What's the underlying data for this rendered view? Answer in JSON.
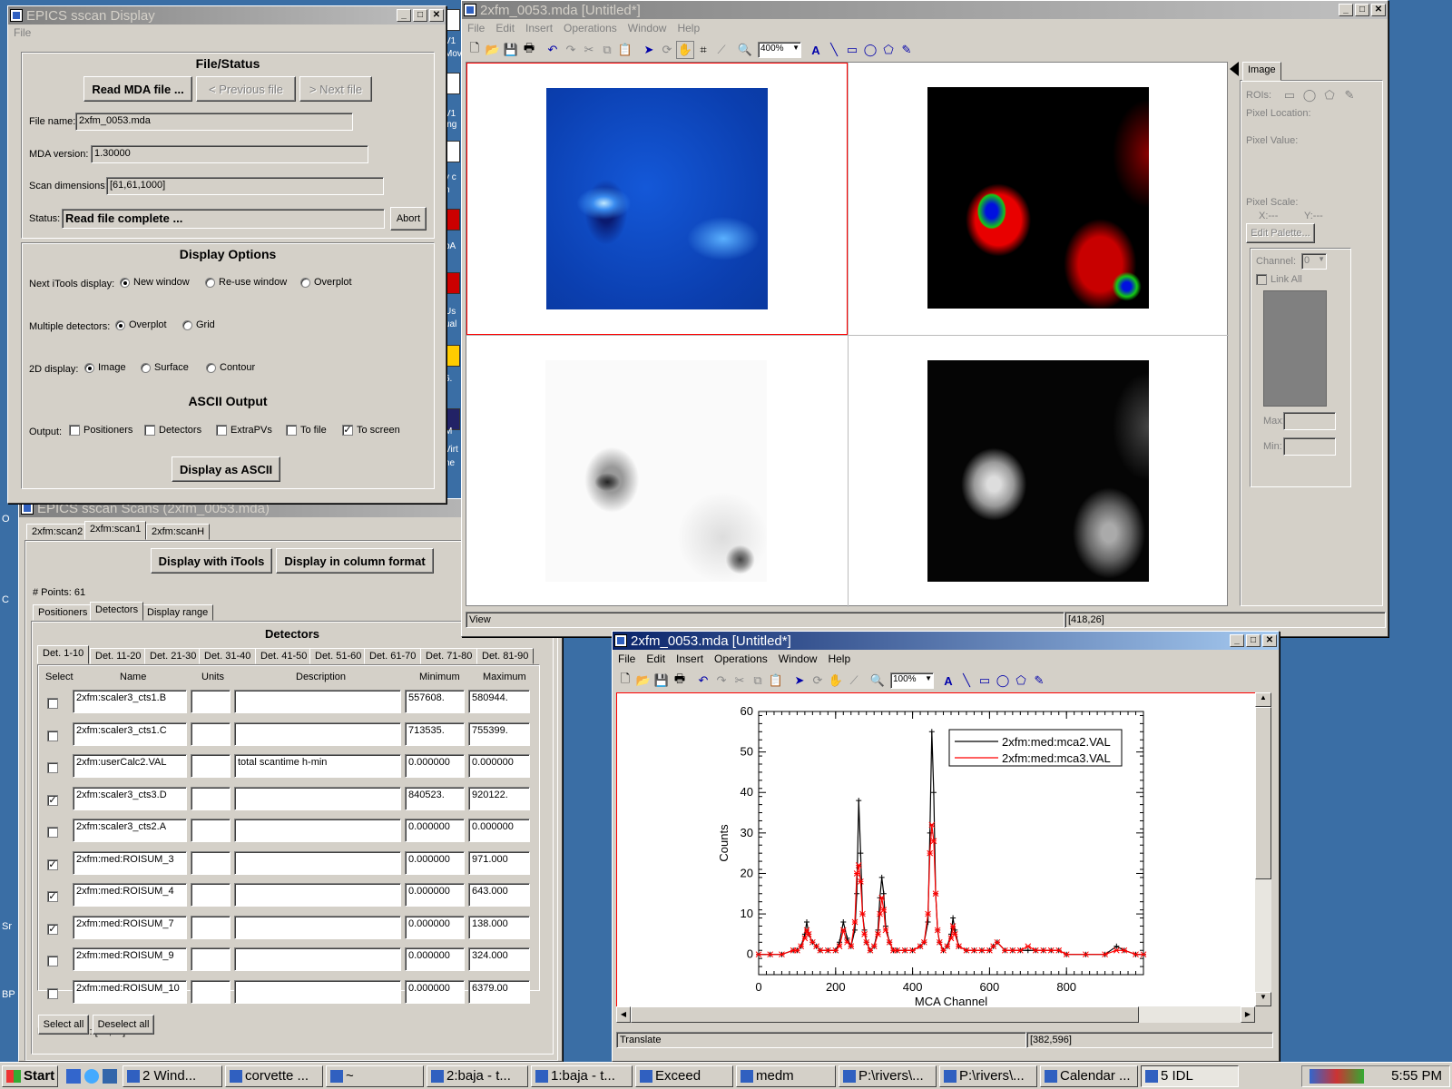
{
  "desktop": {
    "left_labels": [
      "O",
      "C",
      "Sr",
      "BP"
    ],
    "right_strip": [
      "V1",
      "Mov",
      "V1",
      "ing",
      "y c",
      "n",
      "pA",
      "Us",
      "ual",
      "6.",
      "M",
      "Virt",
      "ne"
    ]
  },
  "sscan": {
    "title": "EPICS sscan Display",
    "menu": [
      "File"
    ],
    "file_status": {
      "heading": "File/Status",
      "read_btn": "Read MDA file ...",
      "prev_btn": "< Previous file",
      "next_btn": "> Next file",
      "file_name_label": "File name:",
      "file_name": "2xfm_0053.mda",
      "mda_version_label": "MDA version:",
      "mda_version": "1.30000",
      "scan_dims_label": "Scan dimensions:",
      "scan_dims": "[61,61,1000]",
      "status_label": "Status:",
      "status": "Read file complete ...",
      "abort_btn": "Abort"
    },
    "display_options": {
      "heading": "Display Options",
      "next_label": "Next iTools display:",
      "next_opts": [
        "New window",
        "Re-use window",
        "Overplot"
      ],
      "multi_label": "Multiple detectors:",
      "multi_opts": [
        "Overplot",
        "Grid"
      ],
      "twod_label": "2D display:",
      "twod_opts": [
        "Image",
        "Surface",
        "Contour"
      ]
    },
    "ascii": {
      "heading": "ASCII Output",
      "output_label": "Output:",
      "opts": [
        "Positioners",
        "Detectors",
        "ExtraPVs",
        "To file",
        "To screen"
      ],
      "display_btn": "Display as ASCII"
    }
  },
  "scans": {
    "title": "EPICS sscan Scans (2xfm_0053.mda)",
    "tabs": [
      "2xfm:scan2",
      "2xfm:scan1",
      "2xfm:scanH"
    ],
    "itools_btn": "Display with iTools",
    "column_btn": "Display in column format",
    "points": "# Points: 61",
    "subtabs": [
      "Positioners",
      "Detectors",
      "Display range"
    ],
    "detectors_heading": "Detectors",
    "det_tabs": [
      "Det. 1-10",
      "Det. 11-20",
      "Det. 21-30",
      "Det. 31-40",
      "Det. 41-50",
      "Det. 51-60",
      "Det. 61-70",
      "Det. 71-80",
      "Det. 81-90"
    ],
    "columns": [
      "Select",
      "Name",
      "Units",
      "Description",
      "Minimum",
      "Maximum"
    ],
    "rows": [
      {
        "checked": false,
        "name": "2xfm:scaler3_cts1.B",
        "units": "",
        "desc": "",
        "min": "557608.",
        "max": "580944."
      },
      {
        "checked": false,
        "name": "2xfm:scaler3_cts1.C",
        "units": "",
        "desc": "",
        "min": "713535.",
        "max": "755399."
      },
      {
        "checked": false,
        "name": "2xfm:userCalc2.VAL",
        "units": "",
        "desc": "total scantime h-min",
        "min": "0.000000",
        "max": "0.000000"
      },
      {
        "checked": true,
        "name": "2xfm:scaler3_cts3.D",
        "units": "",
        "desc": "",
        "min": "840523.",
        "max": "920122."
      },
      {
        "checked": false,
        "name": "2xfm:scaler3_cts2.A",
        "units": "",
        "desc": "",
        "min": "0.000000",
        "max": "0.000000"
      },
      {
        "checked": true,
        "name": "2xfm:med:ROISUM_3",
        "units": "",
        "desc": "",
        "min": "0.000000",
        "max": "971.000"
      },
      {
        "checked": true,
        "name": "2xfm:med:ROISUM_4",
        "units": "",
        "desc": "",
        "min": "0.000000",
        "max": "643.000"
      },
      {
        "checked": true,
        "name": "2xfm:med:ROISUM_7",
        "units": "",
        "desc": "",
        "min": "0.000000",
        "max": "138.000"
      },
      {
        "checked": false,
        "name": "2xfm:med:ROISUM_9",
        "units": "",
        "desc": "",
        "min": "0.000000",
        "max": "324.000"
      },
      {
        "checked": false,
        "name": "2xfm:med:ROISUM_10",
        "units": "",
        "desc": "",
        "min": "0.000000",
        "max": "6379.00"
      }
    ],
    "dimensions": "Dimensions: [61,61]",
    "select_all": "Select all",
    "deselect_all": "Deselect all"
  },
  "itools1": {
    "title": "2xfm_0053.mda [Untitled*]",
    "menu": [
      "File",
      "Edit",
      "Insert",
      "Operations",
      "Window",
      "Help"
    ],
    "zoom": "400%",
    "status_left": "View",
    "status_right": "[418,26]",
    "panel": {
      "tab": "Image",
      "rois_label": "ROIs:",
      "pixel_location": "Pixel Location:",
      "pixel_value": "Pixel Value:",
      "pixel_scale": "Pixel Scale:",
      "x_label": "X:---",
      "y_label": "Y:---",
      "edit_palette": "Edit Palette...",
      "channel_label": "Channel:",
      "channel_value": "0",
      "link_all": "Link All",
      "max_label": "Max:",
      "min_label": "Min:"
    }
  },
  "itools2": {
    "title": "2xfm_0053.mda [Untitled*]",
    "menu": [
      "File",
      "Edit",
      "Insert",
      "Operations",
      "Window",
      "Help"
    ],
    "zoom": "100%",
    "status_left": "Translate",
    "status_right": "[382,596]"
  },
  "chart_data": {
    "type": "line",
    "xlabel": "MCA Channel",
    "ylabel": "Counts",
    "xlim": [
      0,
      1000
    ],
    "ylim": [
      -5,
      60
    ],
    "xticks": [
      0,
      200,
      400,
      600,
      800
    ],
    "yticks": [
      0,
      10,
      20,
      30,
      40,
      50,
      60
    ],
    "legend": "top-right",
    "series": [
      {
        "name": "2xfm:med:mca2.VAL",
        "color": "#000000",
        "marker": "+",
        "x": [
          0,
          30,
          60,
          90,
          100,
          110,
          120,
          125,
          130,
          140,
          150,
          160,
          180,
          200,
          210,
          220,
          230,
          240,
          250,
          255,
          260,
          265,
          270,
          275,
          280,
          290,
          300,
          310,
          315,
          320,
          325,
          330,
          340,
          350,
          360,
          380,
          400,
          420,
          430,
          440,
          445,
          450,
          455,
          460,
          465,
          470,
          480,
          490,
          500,
          505,
          510,
          520,
          540,
          560,
          580,
          600,
          610,
          620,
          640,
          660,
          680,
          700,
          720,
          740,
          760,
          780,
          800,
          850,
          900,
          930,
          950,
          980,
          1000
        ],
        "y": [
          0,
          0,
          0,
          1,
          1,
          2,
          5,
          8,
          5,
          3,
          2,
          1,
          1,
          1,
          3,
          8,
          4,
          2,
          6,
          15,
          38,
          25,
          10,
          6,
          3,
          1,
          2,
          6,
          14,
          19,
          15,
          7,
          3,
          1,
          1,
          1,
          1,
          2,
          3,
          8,
          30,
          55,
          40,
          15,
          6,
          3,
          1,
          2,
          5,
          9,
          6,
          2,
          1,
          1,
          1,
          1,
          2,
          3,
          1,
          1,
          1,
          1,
          1,
          1,
          1,
          1,
          0,
          0,
          0,
          2,
          1,
          0,
          0
        ]
      },
      {
        "name": "2xfm:med:mca3.VAL",
        "color": "#ff0000",
        "marker": "*",
        "x": [
          0,
          30,
          60,
          90,
          100,
          110,
          120,
          125,
          130,
          140,
          150,
          160,
          180,
          200,
          210,
          220,
          230,
          240,
          250,
          255,
          260,
          265,
          270,
          275,
          280,
          290,
          300,
          310,
          315,
          320,
          325,
          330,
          340,
          350,
          360,
          380,
          400,
          420,
          430,
          440,
          445,
          450,
          455,
          460,
          465,
          470,
          480,
          490,
          500,
          505,
          510,
          520,
          540,
          560,
          580,
          600,
          610,
          620,
          640,
          660,
          680,
          700,
          720,
          740,
          760,
          780,
          800,
          850,
          900,
          930,
          950,
          980,
          1000
        ],
        "y": [
          0,
          0,
          0,
          1,
          1,
          2,
          4,
          6,
          5,
          3,
          2,
          1,
          1,
          1,
          2,
          6,
          3,
          2,
          8,
          20,
          22,
          18,
          10,
          5,
          3,
          1,
          2,
          5,
          10,
          14,
          11,
          6,
          3,
          1,
          1,
          1,
          1,
          2,
          3,
          10,
          25,
          32,
          28,
          15,
          6,
          3,
          1,
          2,
          4,
          7,
          5,
          2,
          1,
          1,
          1,
          1,
          2,
          3,
          1,
          1,
          1,
          2,
          1,
          1,
          1,
          1,
          0,
          0,
          0,
          1,
          1,
          0,
          0
        ]
      }
    ]
  },
  "taskbar": {
    "start": "Start",
    "items": [
      "2 Wind...",
      "corvette ...",
      "~",
      "2:baja - t...",
      "1:baja - t...",
      "Exceed",
      "medm",
      "P:\\rivers\\...",
      "P:\\rivers\\...",
      "Calendar ...",
      "5 IDL"
    ],
    "clock": "5:55 PM"
  },
  "colors": {
    "desktop": "#3a6ea5",
    "face": "#d4d0c8",
    "title_active": "#0a246a"
  }
}
